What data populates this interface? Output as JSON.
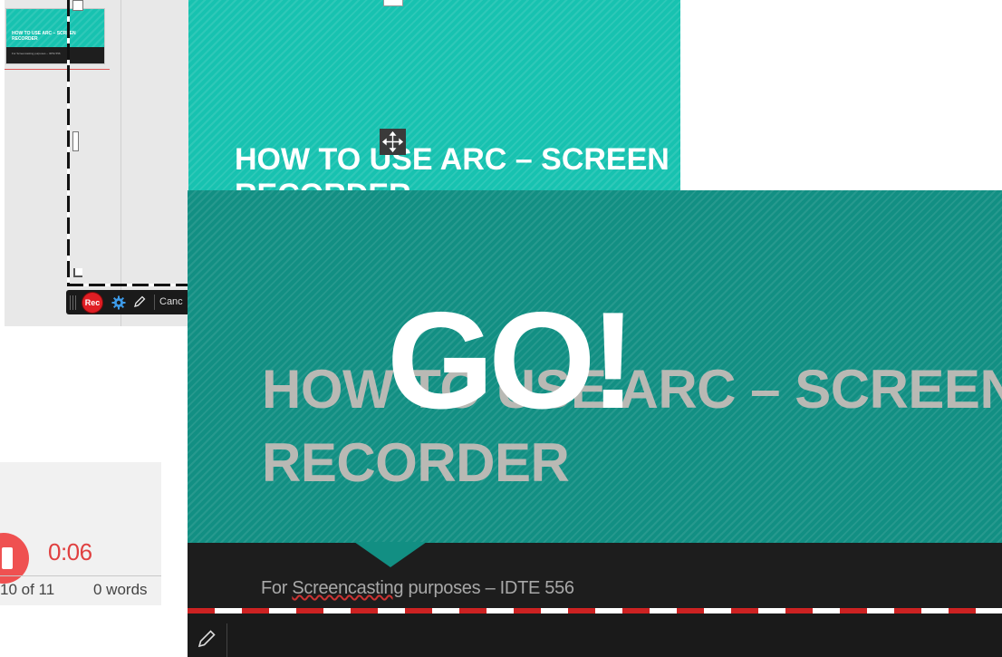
{
  "editor": {
    "thumbnail": {
      "title": "HOW TO USE ARC – SCREEN RECORDER",
      "subtitle": "For Screencasting purposes – IDTE 556"
    }
  },
  "recorder_toolbar": {
    "rec_label": "Rec",
    "cancel_label": "Canc"
  },
  "slide_edit": {
    "title_line_1": "HOW TO USE ARC – SCREEN",
    "title_line_2": "RECORDER"
  },
  "word_widget": {
    "timer": "0:06",
    "page_count": "10 of 11",
    "word_count": "0 words"
  },
  "slide_big": {
    "title_line_1": "HOW TO USE ARC – SCREEN",
    "title_line_2": "RECORDER",
    "overlay": "GO!",
    "subtitle_prefix": "For ",
    "subtitle_word": "Screencasting",
    "subtitle_suffix": " purposes – IDTE 556"
  },
  "colors": {
    "teal": "#17c2b0",
    "teal_dark": "#128f83",
    "rec_red": "#e01e24",
    "timer_red": "#e04040"
  },
  "icons": [
    "gear-icon",
    "pencil-icon",
    "move-icon"
  ]
}
